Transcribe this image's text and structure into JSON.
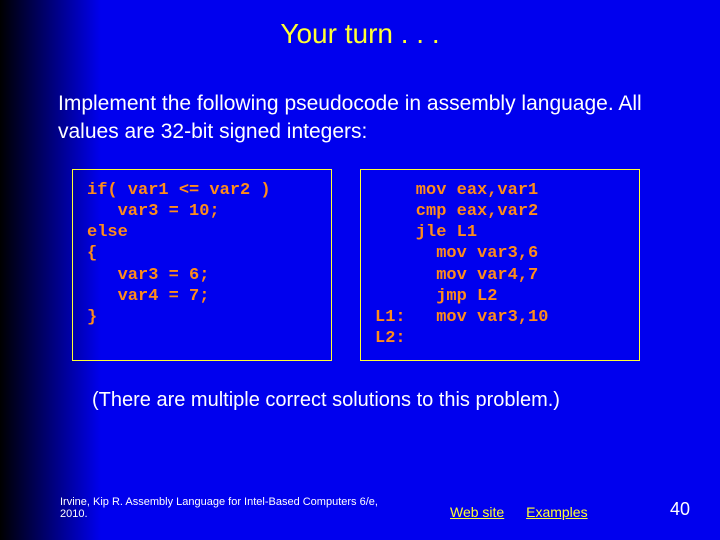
{
  "title": "Your turn . . .",
  "intro": "Implement the following pseudocode in assembly language. All values are 32-bit signed integers:",
  "code_left": "if( var1 <= var2 )\n   var3 = 10;\nelse\n{\n   var3 = 6;\n   var4 = 7;\n}",
  "code_right": "    mov eax,var1\n    cmp eax,var2\n    jle L1\n      mov var3,6\n      mov var4,7\n      jmp L2\nL1:   mov var3,10\nL2:",
  "note": "(There are multiple correct solutions to this problem.)",
  "footer_citation": "Irvine, Kip R. Assembly Language for Intel-Based Computers 6/e, 2010.",
  "link_website": "Web site",
  "link_examples": "Examples",
  "page_number": "40"
}
